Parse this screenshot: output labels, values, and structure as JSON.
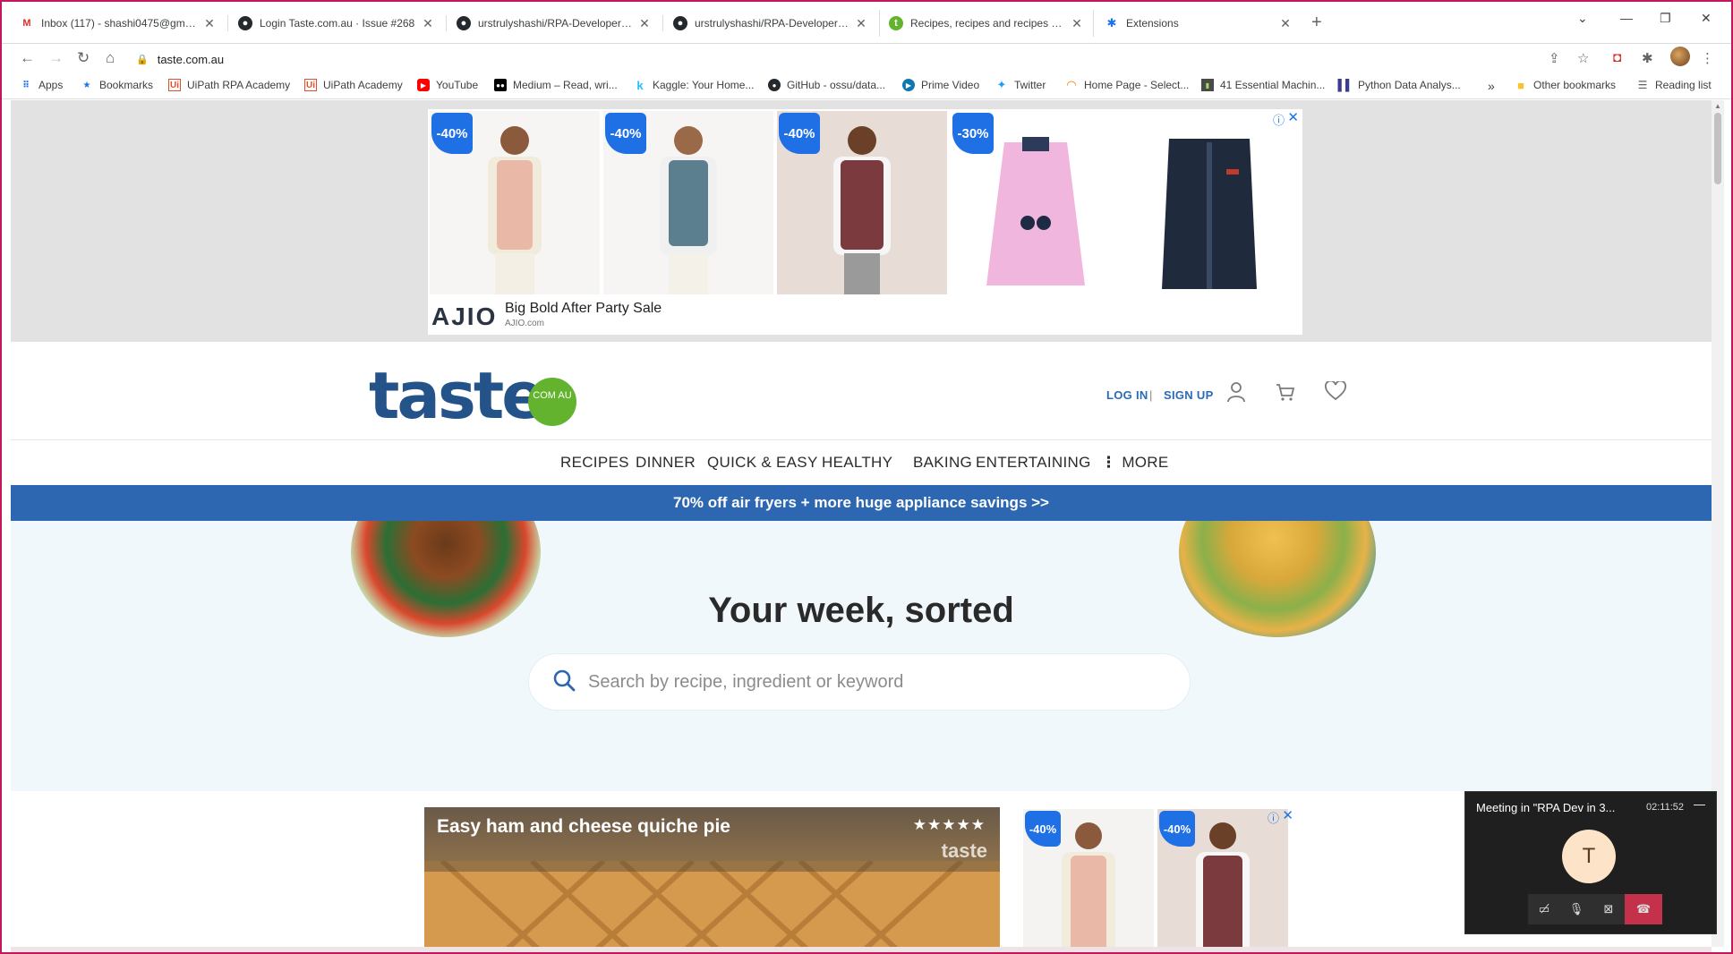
{
  "tabs": [
    {
      "title": "Inbox (117) - shashi0475@gmail.com",
      "icon": "gmail-icon"
    },
    {
      "title": "Login Taste.com.au · Issue #268",
      "icon": "github-icon"
    },
    {
      "title": "urstrulyshashi/RPA-Developer-in",
      "icon": "github-icon"
    },
    {
      "title": "urstrulyshashi/RPA-Developer-in",
      "icon": "github-icon"
    },
    {
      "title": "Recipes, recipes and recipes - Taste",
      "icon": "taste-icon",
      "active": true
    },
    {
      "title": "Extensions",
      "icon": "puzzle-icon"
    }
  ],
  "address": {
    "url": "taste.com.au"
  },
  "bookmarks": [
    {
      "label": "Apps"
    },
    {
      "label": "Bookmarks"
    },
    {
      "label": "UiPath RPA Academy"
    },
    {
      "label": "UiPath Academy"
    },
    {
      "label": "YouTube"
    },
    {
      "label": "Medium – Read, wri..."
    },
    {
      "label": "Kaggle: Your Home..."
    },
    {
      "label": "GitHub - ossu/data..."
    },
    {
      "label": "Prime Video"
    },
    {
      "label": "Twitter"
    },
    {
      "label": "Home Page - Select..."
    },
    {
      "label": "41 Essential Machin..."
    },
    {
      "label": "Python Data Analys..."
    },
    {
      "label": "»"
    },
    {
      "label": "Other bookmarks"
    },
    {
      "label": "Reading list"
    }
  ],
  "ad_top": {
    "badges": [
      "-40%",
      "-40%",
      "-40%",
      "-30%",
      ""
    ],
    "brand": "AJIO",
    "title": "Big Bold After Party Sale",
    "url": "AJIO.com"
  },
  "site": {
    "logo": "taste",
    "logo_badge": "COM AU",
    "login": "LOG IN",
    "divider": "|",
    "signup": "SIGN UP"
  },
  "nav": [
    "RECIPES",
    "DINNER",
    "QUICK & EASY",
    "HEALTHY",
    "BAKING",
    "ENTERTAINING",
    "MORE"
  ],
  "promo": "70% off air fryers + more huge appliance savings >>",
  "hero": {
    "title": "Your week, sorted",
    "search_placeholder": "Search by recipe, ingredient or keyword"
  },
  "feature": {
    "title": "Easy ham and cheese quiche pie",
    "stars": "★★★★★",
    "watermark": "taste"
  },
  "ad_bottom": {
    "badges": [
      "-40%",
      "-40%"
    ]
  },
  "meeting": {
    "title": "Meeting in \"RPA Dev in 3...",
    "time": "02:11:52",
    "avatar_initial": "T"
  },
  "colors": {
    "brand_blue": "#24538a",
    "promo_blue": "#2d66b1",
    "badge_blue": "#1f6fe5",
    "taste_green": "#63b32e"
  }
}
